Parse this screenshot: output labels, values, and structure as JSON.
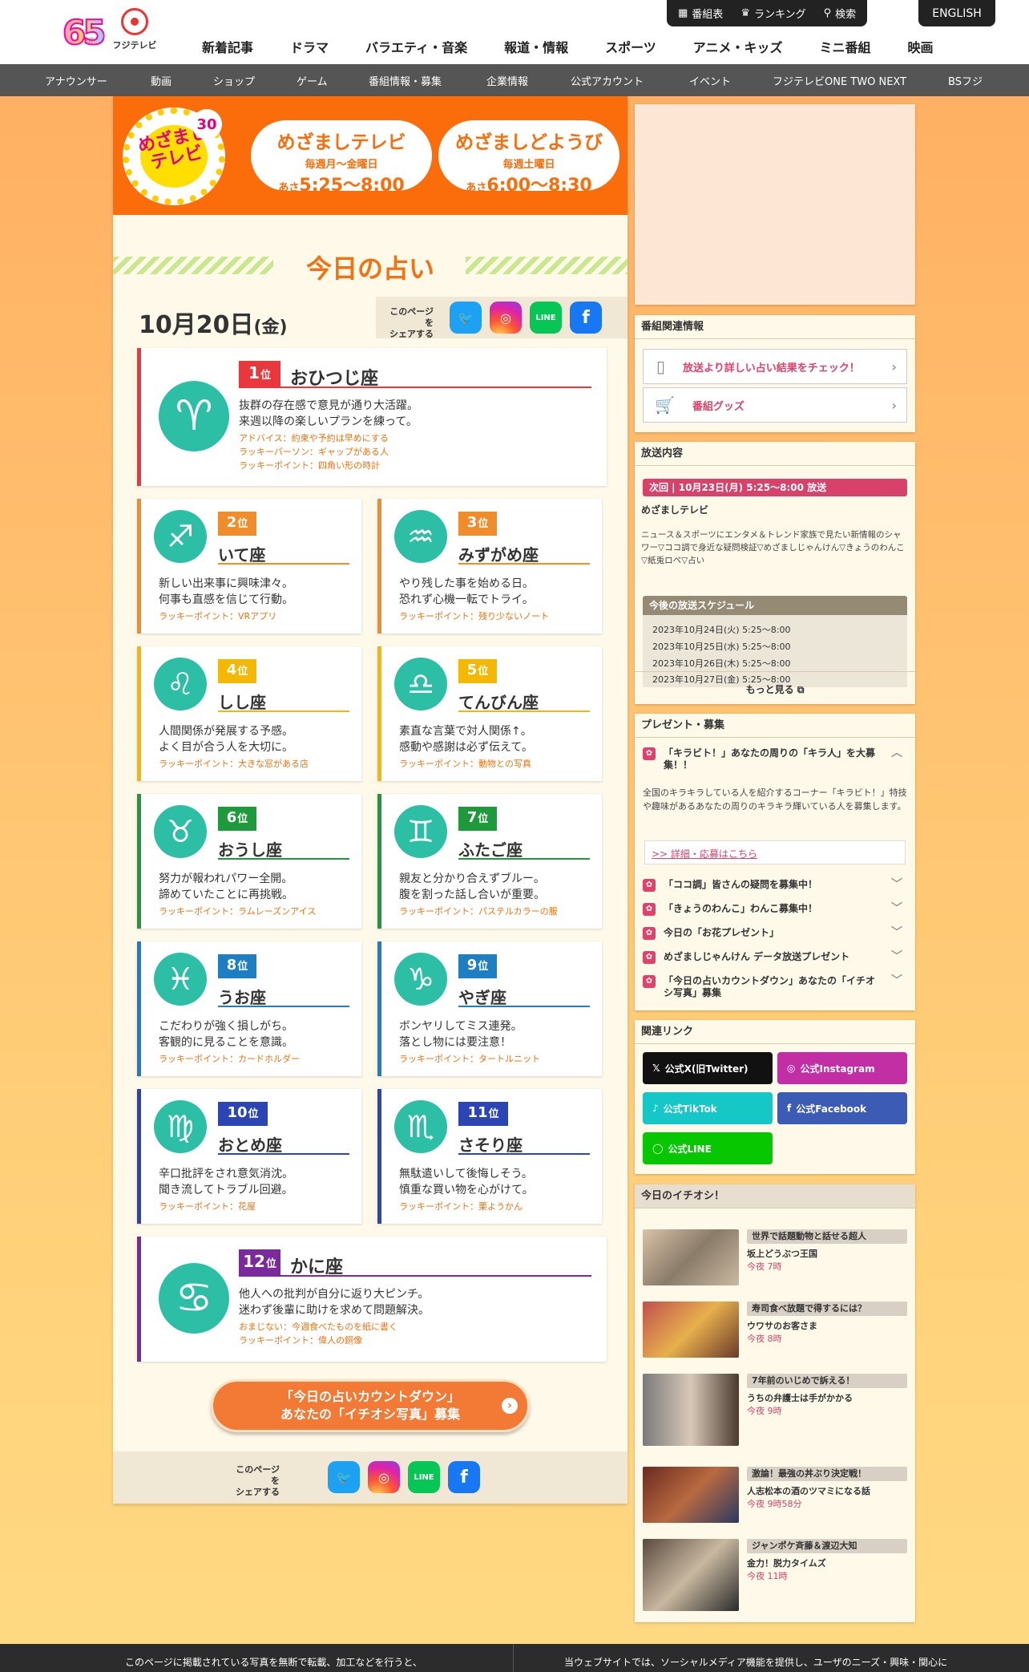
{
  "header": {
    "brand_65": "65",
    "brand_th": "th",
    "brand_fuji": "フジテレビ",
    "top_buttons": [
      "番組表",
      "ランキング",
      "検索"
    ],
    "english": "ENGLISH",
    "main_nav": [
      "新着記事",
      "ドラマ",
      "バラエティ・音楽",
      "報道・情報",
      "スポーツ",
      "アニメ・キッズ",
      "ミニ番組",
      "映画"
    ],
    "sub_nav": [
      "アナウンサー",
      "動画",
      "ショップ",
      "ゲーム",
      "番組情報・募集",
      "企業情報",
      "公式アカウント",
      "イベント",
      "フジテレビONE TWO NEXT",
      "BSフジ"
    ]
  },
  "banner": {
    "logo_text": "めざましテレビ",
    "logo_30": "30",
    "pill1": {
      "title": "めざましテレビ",
      "days": "毎週月〜金曜日",
      "time_prefix": "あさ",
      "time": "5:25〜8:00"
    },
    "pill2": {
      "title": "めざましどようび",
      "days": "毎週土曜日",
      "time_prefix": "あさ",
      "time": "6:00〜8:30"
    }
  },
  "page_title": "今日の占い",
  "date": {
    "md": "10月20日",
    "wd": "(金)"
  },
  "share_label_1": "このページを",
  "share_label_2": "シェアする",
  "share": {
    "twitter": "twitter-icon",
    "instagram": "instagram-icon",
    "line": "LINE",
    "facebook": "f"
  },
  "rank_suffix": "位",
  "fortunes": [
    {
      "rank": "1",
      "name": "おひつじ座",
      "glyph": "♈",
      "color": "#e8383d",
      "lines": [
        "抜群の存在感で意見が通り大活躍。",
        "来週以降の楽しいプランを練って。"
      ],
      "lucky": [
        "アドバイス：約束や予約は早めにする",
        "ラッキーパーソン：ギャップがある人",
        "ラッキーポイント：四角い形の時計"
      ]
    },
    {
      "rank": "2",
      "name": "いて座",
      "glyph": "♐",
      "color": "#f08c2a",
      "lines": [
        "新しい出来事に興味津々。",
        "何事も直感を信じて行動。"
      ],
      "lucky": [
        "ラッキーポイント：VRアプリ"
      ]
    },
    {
      "rank": "3",
      "name": "みずがめ座",
      "glyph": "♒",
      "color": "#f08c2a",
      "lines": [
        "やり残した事を始める日。",
        "恐れず心機一転でトライ。"
      ],
      "lucky": [
        "ラッキーポイント：残り少ないノート"
      ]
    },
    {
      "rank": "4",
      "name": "しし座",
      "glyph": "♌",
      "color": "#f5b800",
      "lines": [
        "人間関係が発展する予感。",
        "よく目が合う人を大切に。"
      ],
      "lucky": [
        "ラッキーポイント：大きな窓がある店"
      ]
    },
    {
      "rank": "5",
      "name": "てんびん座",
      "glyph": "♎",
      "color": "#f5b800",
      "lines": [
        "素直な言葉で対人関係↑。",
        "感動や感謝は必ず伝えて。"
      ],
      "lucky": [
        "ラッキーポイント：動物との写真"
      ]
    },
    {
      "rank": "6",
      "name": "おうし座",
      "glyph": "♉",
      "color": "#1e9a3c",
      "lines": [
        "努力が報われパワー全開。",
        "諦めていたことに再挑戦。"
      ],
      "lucky": [
        "ラッキーポイント：ラムレーズンアイス"
      ]
    },
    {
      "rank": "7",
      "name": "ふたご座",
      "glyph": "♊",
      "color": "#1e9a3c",
      "lines": [
        "親友と分かり合えずブルー。",
        "腹を割った話し合いが重要。"
      ],
      "lucky": [
        "ラッキーポイント：パステルカラーの服"
      ]
    },
    {
      "rank": "8",
      "name": "うお座",
      "glyph": "♓",
      "color": "#1d7fc2",
      "lines": [
        "こだわりが強く損しがち。",
        "客観的に見ることを意識。"
      ],
      "lucky": [
        "ラッキーポイント：カードホルダー"
      ]
    },
    {
      "rank": "9",
      "name": "やぎ座",
      "glyph": "♑",
      "color": "#1d7fc2",
      "lines": [
        "ボンヤリしてミス連発。",
        "落とし物には要注意！"
      ],
      "lucky": [
        "ラッキーポイント：タートルニット"
      ]
    },
    {
      "rank": "10",
      "name": "おとめ座",
      "glyph": "♍",
      "color": "#2b46b4",
      "lines": [
        "辛口批評をされ意気消沈。",
        "聞き流してトラブル回避。"
      ],
      "lucky": [
        "ラッキーポイント：花屋"
      ]
    },
    {
      "rank": "11",
      "name": "さそり座",
      "glyph": "♏",
      "color": "#2b46b4",
      "lines": [
        "無駄遣いして後悔しそう。",
        "慎重な買い物を心がけて。"
      ],
      "lucky": [
        "ラッキーポイント：栗ようかん"
      ]
    },
    {
      "rank": "12",
      "name": "かに座",
      "glyph": "♋",
      "color": "#7b2a9c",
      "lines": [
        "他人への批判が自分に返り大ピンチ。",
        "迷わず後輩に助けを求めて問題解決。"
      ],
      "lucky": [
        "おまじない：今週食べたものを紙に書く",
        "ラッキーポイント：偉人の銅像"
      ]
    }
  ],
  "cta": {
    "line1": "「今日の占いカウントダウン」",
    "line2": "あなたの「イチオシ写真」募集",
    "arrow": "›"
  },
  "sidebar": {
    "related_title": "番組関連情報",
    "related_links": [
      "放送より詳しい占い結果をチェック！",
      "番組グッズ"
    ],
    "broadcast_title": "放送内容",
    "next_bar": "次回 | 10月23日(月) 5:25〜8:00 放送",
    "program_name": "めざましテレビ",
    "program_desc": "ニュース＆スポーツにエンタメ＆トレンド家族で見たい新情報のシャワー▽ココ調で身近な疑問検証▽めざましじゃんけん▽きょうのわんこ▽紙兎ロペ▽占い",
    "schedule_title": "今後の放送スケジュール",
    "schedule": [
      "2023年10月24日(火) 5:25〜8:00",
      "2023年10月25日(水) 5:25〜8:00",
      "2023年10月26日(木) 5:25〜8:00",
      "2023年10月27日(金) 5:25〜8:00"
    ],
    "more": "もっと見る",
    "present_title": "プレゼント・募集",
    "present_first": "「キラビト！」あなたの周りの「キラ人」を大募集！！",
    "present_body": "全国のキラキラしている人を紹介するコーナー「キラビト！」特技や趣味があるあなたの周りのキラキラ輝いている人を募集します。",
    "present_link": ">> 詳細・応募はこちら",
    "present_items": [
      "「ココ調」皆さんの疑問を募集中！",
      "「きょうのわんこ」わんこ募集中！",
      "今日の「お花プレゼント」",
      "めざましじゃんけん データ放送プレゼント",
      "「今日の占いカウントダウン」あなたの「イチオシ写真」募集"
    ],
    "links_title": "関連リンク",
    "sns": [
      "公式X(旧Twitter)",
      "公式Instagram",
      "公式TikTok",
      "公式Facebook",
      "公式LINE"
    ],
    "pick_title": "今日のイチオシ！",
    "picks": [
      {
        "tag": "世界で話題動物と話せる超人",
        "title": "坂上どうぶつ王国",
        "time": "今夜 7時"
      },
      {
        "tag": "寿司食べ放題で得するには？",
        "title": "ウワサのお客さま",
        "time": "今夜 8時"
      },
      {
        "tag": "7年前のいじめで訴える！",
        "title": "うちの弁護士は手がかかる",
        "time": "今夜 9時"
      },
      {
        "tag": "激論！最強の丼ぶり決定戦！",
        "title": "人志松本の酒のツマミになる話",
        "time": "今夜 9時58分"
      },
      {
        "tag": "ジャンポケ斉藤＆渡辺大知",
        "title": "金力！脱力タイムズ",
        "time": "今夜 11時"
      }
    ]
  },
  "footer": {
    "left": "このページに掲載されている写真を無断で転載、加工などを行うと、",
    "right": "当ウェブサイトでは、ソーシャルメディア機能を提供し、ユーザのニーズ・興味・関心に"
  }
}
